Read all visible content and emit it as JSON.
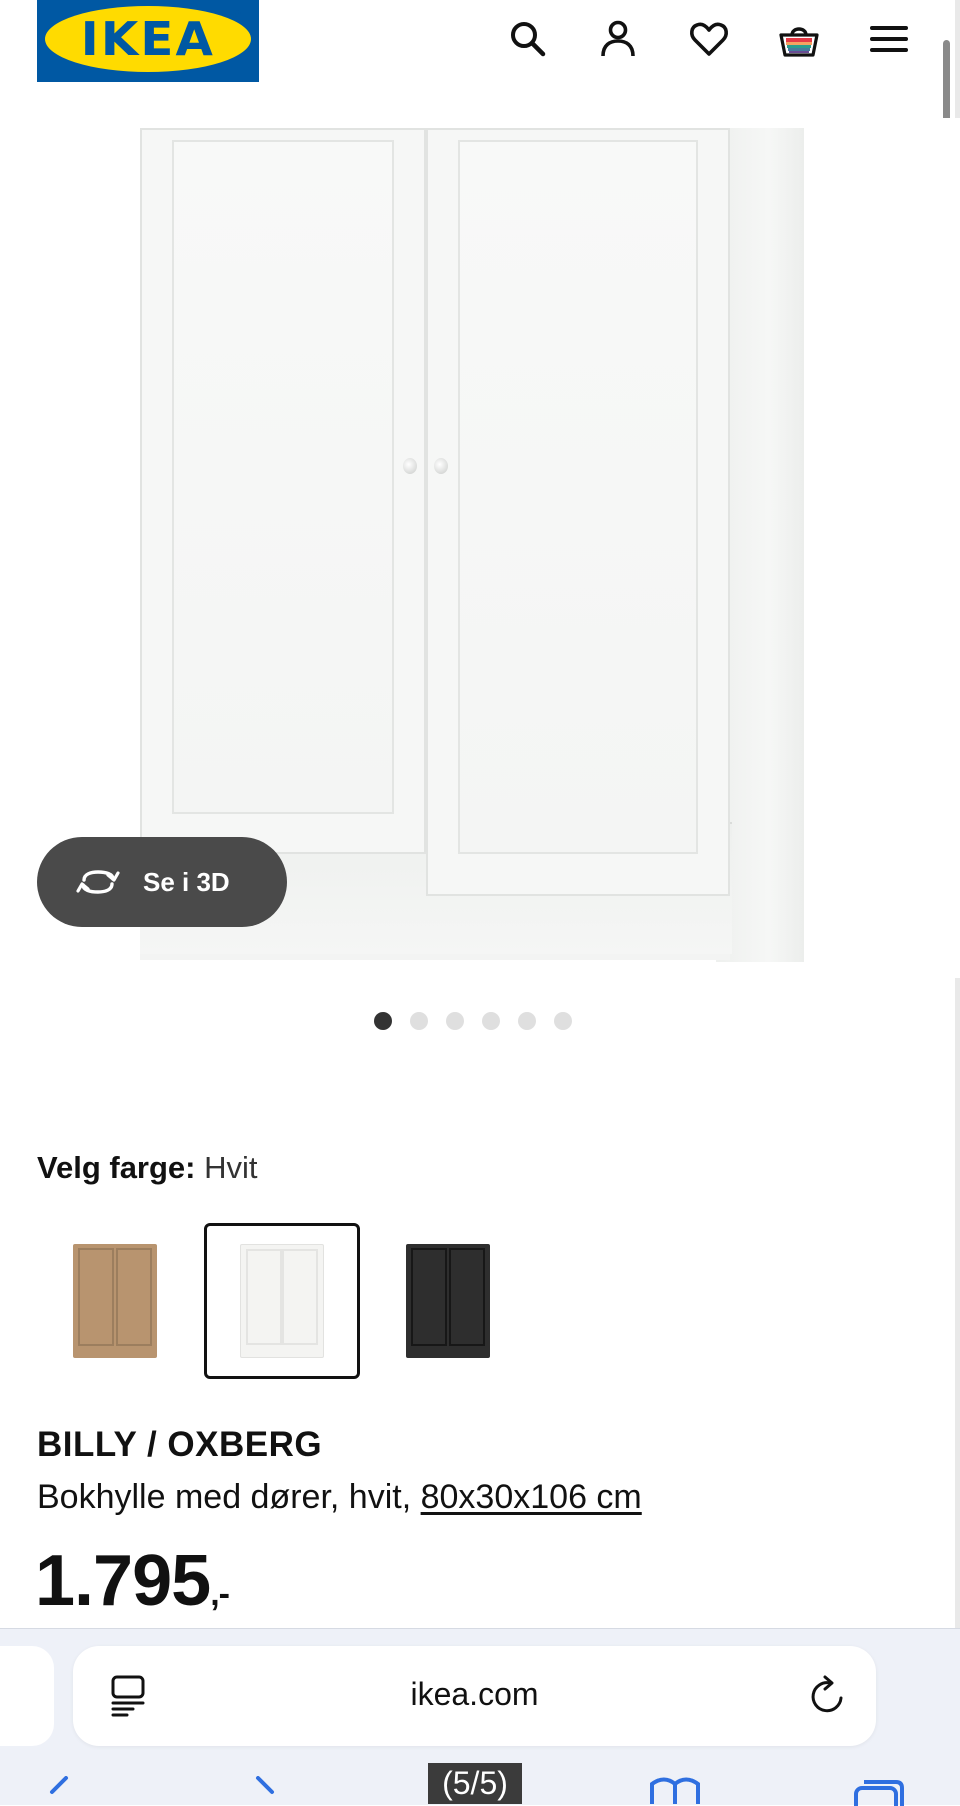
{
  "header": {
    "logo_text": "IKEA",
    "logo_registered": "®",
    "icons": [
      "search-icon",
      "account-icon",
      "heart-icon",
      "basket-icon",
      "menu-icon"
    ]
  },
  "gallery": {
    "view_3d_label": "Se i 3D",
    "current_image": 1,
    "image_count": 6
  },
  "color_picker": {
    "label": "Velg farge:",
    "selected": "Hvit",
    "swatches": [
      {
        "color": "#b8946f",
        "name": "oak"
      },
      {
        "color": "#f4f4f2",
        "name": "white",
        "selected": true
      },
      {
        "color": "#2e2e2e",
        "name": "black"
      }
    ]
  },
  "product": {
    "name": "BILLY / OXBERG",
    "description": "Bokhylle med dører, hvit, ",
    "dimensions": "80x30x106 cm",
    "price": "1.795",
    "price_suffix": ",-"
  },
  "browser": {
    "url": "ikea.com",
    "page_counter": "(5/5)"
  }
}
